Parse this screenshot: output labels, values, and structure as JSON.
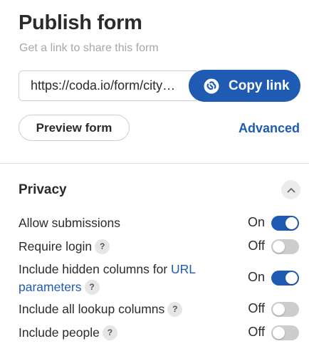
{
  "header": {
    "title": "Publish form",
    "subtitle": "Get a link to share this form"
  },
  "share": {
    "url": "https://coda.io/form/city…",
    "copy_label": "Copy link",
    "copy_icon": "link-globe-icon"
  },
  "actions": {
    "preview_label": "Preview form",
    "advanced_label": "Advanced"
  },
  "privacy": {
    "title": "Privacy",
    "collapse_icon": "chevron-up-icon",
    "settings": [
      {
        "label": "Allow submissions",
        "state": "On",
        "help": false
      },
      {
        "label": "Require login",
        "state": "Off",
        "help": true,
        "help_text": "?"
      },
      {
        "label": "Include hidden columns for ",
        "label_link": "URL parameters",
        "state": "On",
        "help": true,
        "help_text": "?"
      },
      {
        "label": "Include all lookup columns",
        "state": "Off",
        "help": true,
        "help_text": "?"
      },
      {
        "label": "Include people",
        "state": "Off",
        "help": true,
        "help_text": "?"
      }
    ]
  },
  "colors": {
    "accent": "#1f5bb3",
    "toggle_off": "#cdcdcd"
  }
}
